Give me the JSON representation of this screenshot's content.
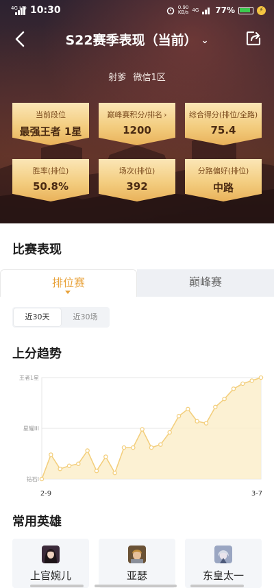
{
  "status_bar": {
    "network": "4G HD",
    "time": "10:30",
    "speed_value": "0.90",
    "speed_unit": "KB/s",
    "network2": "4G",
    "battery_pct": "77%",
    "battery_level": 0.77
  },
  "header": {
    "title": "S22赛季表现（当前）"
  },
  "player": {
    "role": "射爹",
    "server": "微信1区"
  },
  "stats": [
    {
      "label": "当前段位",
      "value": "最强王者 1星"
    },
    {
      "label": "巅峰赛积分/排名",
      "value": "1200",
      "has_arrow": true
    },
    {
      "label": "综合得分(排位/全路)",
      "value": "75.4"
    },
    {
      "label": "胜率(排位)",
      "value": "50.8%"
    },
    {
      "label": "场次(排位)",
      "value": "392"
    },
    {
      "label": "分路偏好(排位)",
      "value": "中路"
    }
  ],
  "match_section": {
    "title": "比赛表现",
    "tabs": [
      "排位赛",
      "巅峰赛"
    ],
    "active_tab": "排位赛",
    "ranges": [
      "近30天",
      "近30场"
    ],
    "active_range": "近30天"
  },
  "trend": {
    "title": "上分趋势"
  },
  "chart_data": {
    "type": "line",
    "title": "上分趋势",
    "y_tick_labels": [
      "钻石I",
      "星耀III",
      "王者1星"
    ],
    "y_ticks": [
      0,
      50,
      100
    ],
    "ylim": [
      0,
      100
    ],
    "x_tick_labels": [
      "2-9",
      "3-7"
    ],
    "values": [
      0,
      24,
      10,
      13,
      15,
      28,
      8,
      22,
      6,
      31,
      31,
      49,
      31,
      34,
      46,
      62,
      69,
      57,
      55,
      71,
      79,
      89,
      94,
      97,
      100
    ],
    "grid": true,
    "color": "#f3cf7e",
    "fill": "#fbeecb"
  },
  "heroes_section": {
    "title": "常用英雄",
    "heroes": [
      {
        "name": "上官婉儿",
        "icon": "hero-shangguan-avatar"
      },
      {
        "name": "亚瑟",
        "icon": "hero-arthur-avatar"
      },
      {
        "name": "东皇太一",
        "icon": "hero-donghuang-avatar"
      }
    ]
  },
  "colors": {
    "accent": "#e8a23a",
    "card_gold": "#f3cd80",
    "battery_green": "#3ccc4f"
  }
}
